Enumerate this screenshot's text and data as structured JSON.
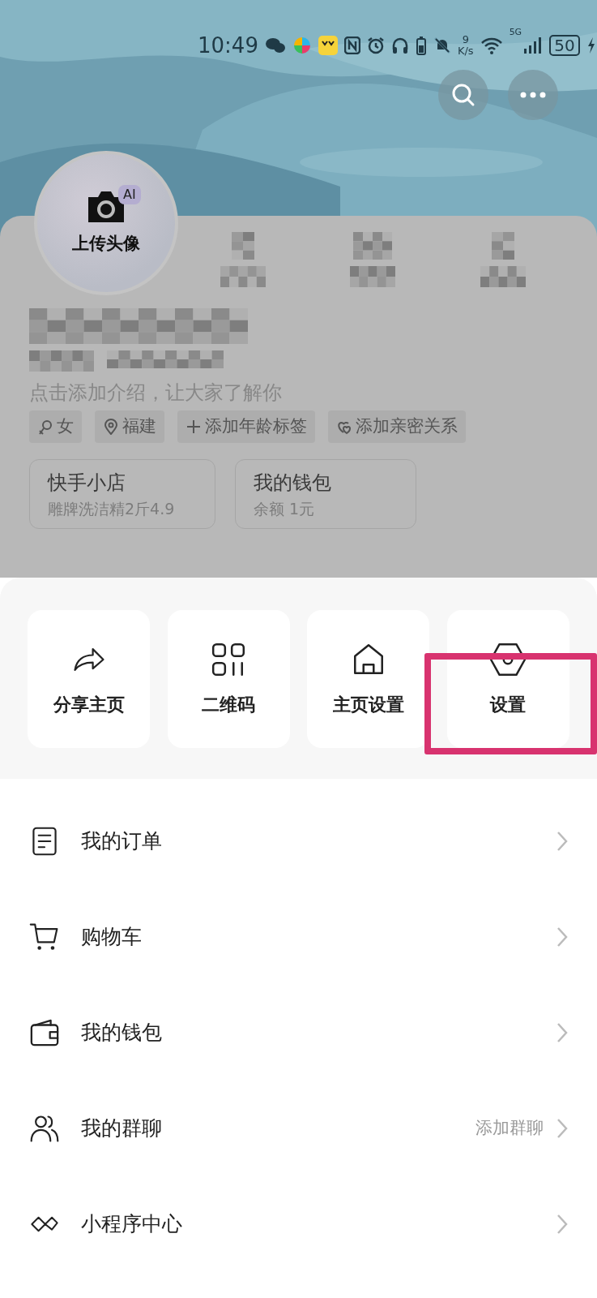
{
  "status_bar": {
    "time": "10:49",
    "net_speed_value": "9",
    "net_speed_unit": "K/s",
    "network": "5G",
    "battery": "50"
  },
  "header_buttons": [
    {
      "kind": "search"
    },
    {
      "kind": "more"
    }
  ],
  "profile": {
    "avatar_label": "上传头像",
    "ai_badge": "AI",
    "intro": "点击添加介绍，让大家了解你",
    "tags": [
      {
        "kind": "gender",
        "label": "女"
      },
      {
        "kind": "location",
        "label": "福建"
      },
      {
        "kind": "plus",
        "label": "添加年龄标签"
      },
      {
        "kind": "hearts",
        "label": "添加亲密关系"
      }
    ],
    "shortcuts": [
      {
        "title": "快手小店",
        "subtitle": "雕牌洗洁精2斤4.9"
      },
      {
        "title": "我的钱包",
        "subtitle": "余额 1元"
      }
    ]
  },
  "actions": [
    {
      "kind": "share",
      "label": "分享主页",
      "highlighted": false
    },
    {
      "kind": "qrcode",
      "label": "二维码",
      "highlighted": false
    },
    {
      "kind": "home",
      "label": "主页设置",
      "highlighted": false
    },
    {
      "kind": "settings",
      "label": "设置",
      "highlighted": true
    }
  ],
  "menu": [
    {
      "kind": "order",
      "label": "我的订单"
    },
    {
      "kind": "cart",
      "label": "购物车"
    },
    {
      "kind": "wallet",
      "label": "我的钱包"
    },
    {
      "kind": "group",
      "label": "我的群聊",
      "trailing": "添加群聊"
    },
    {
      "kind": "miniapp",
      "label": "小程序中心"
    }
  ]
}
